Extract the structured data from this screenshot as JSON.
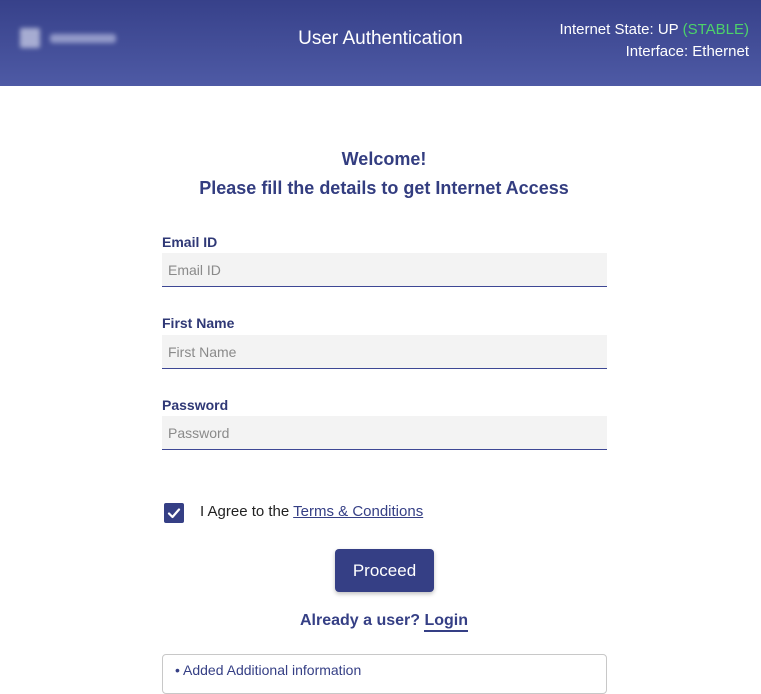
{
  "header": {
    "title": "User Authentication",
    "status_prefix": "Internet State: UP",
    "status_state": "(STABLE)",
    "interface": "Interface: Ethernet",
    "colors": {
      "gradient_top": "#37418a",
      "gradient_bottom": "#4e5aa5",
      "stable": "#4cd26a"
    }
  },
  "welcome": {
    "line1": "Welcome!",
    "line2": "Please fill the details to get Internet Access"
  },
  "form": {
    "email": {
      "label": "Email ID",
      "placeholder": "Email ID",
      "value": ""
    },
    "first_name": {
      "label": "First Name",
      "placeholder": "First Name",
      "value": ""
    },
    "password": {
      "label": "Password",
      "placeholder": "Password",
      "value": ""
    }
  },
  "agree": {
    "checked": true,
    "text": "I Agree to the",
    "link": "Terms & Conditions"
  },
  "proceed_label": "Proceed",
  "login": {
    "prefix": "Already a user?",
    "link": "Login"
  },
  "info": {
    "item": "• Added Additional information"
  },
  "accent_color": "#353f85"
}
